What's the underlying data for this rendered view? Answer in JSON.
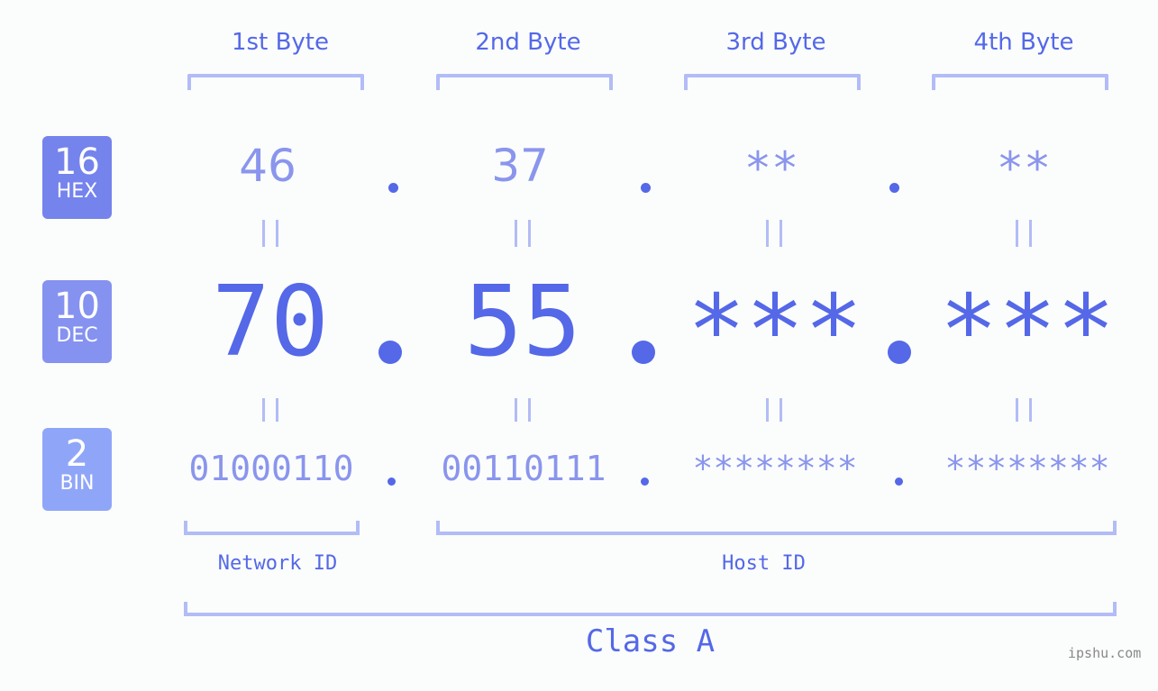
{
  "headers": [
    "1st Byte",
    "2nd Byte",
    "3rd Byte",
    "4th Byte"
  ],
  "badges": {
    "hex": {
      "num": "16",
      "label": "HEX",
      "color": "#7583ec"
    },
    "dec": {
      "num": "10",
      "label": "DEC",
      "color": "#8592f0"
    },
    "bin": {
      "num": "2",
      "label": "BIN",
      "color": "#8fa6f8"
    }
  },
  "hex": [
    "46",
    "37",
    "**",
    "**"
  ],
  "dec": [
    "70",
    "55",
    "***",
    "***"
  ],
  "bin": [
    "01000110",
    "00110111",
    "********",
    "********"
  ],
  "equals": "=",
  "network_id": "Network ID",
  "host_id": "Host ID",
  "class_label": "Class A",
  "watermark": "ipshu.com",
  "colors": {
    "accent": "#5468e8",
    "light": "#8a95ed",
    "bracket": "#b2bcf6"
  }
}
